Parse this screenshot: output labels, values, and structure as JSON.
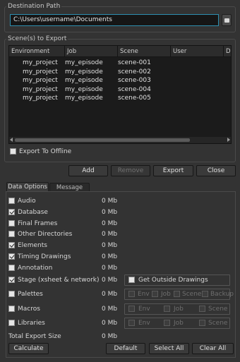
{
  "destination": {
    "legend": "Destination Path",
    "path": "C:\\Users\\username\\Documents"
  },
  "scenes": {
    "legend": "Scene(s) to Export",
    "columns": [
      "Environment",
      "Job",
      "Scene",
      "User",
      "Da"
    ],
    "rows": [
      {
        "environment": "my_project",
        "job": "my_episode",
        "scene": "scene-001"
      },
      {
        "environment": "my_project",
        "job": "my_episode",
        "scene": "scene-002"
      },
      {
        "environment": "my_project",
        "job": "my_episode",
        "scene": "scene-003"
      },
      {
        "environment": "my_project",
        "job": "my_episode",
        "scene": "scene-004"
      },
      {
        "environment": "my_project",
        "job": "my_episode",
        "scene": "scene-005"
      }
    ],
    "export_offline_label": "Export To Offline"
  },
  "actions": {
    "add": "Add",
    "remove": "Remove",
    "export": "Export",
    "close": "Close"
  },
  "tabs": [
    "Data Options",
    "Message Log"
  ],
  "options": [
    {
      "label": "Audio",
      "checked": false,
      "size": "0 Mb"
    },
    {
      "label": "Database",
      "checked": true,
      "size": "0 Mb"
    },
    {
      "label": "Final Frames",
      "checked": false,
      "size": "0 Mb"
    },
    {
      "label": "Other Directories",
      "checked": false,
      "size": "0 Mb"
    },
    {
      "label": "Elements",
      "checked": true,
      "size": "0 Mb"
    },
    {
      "label": "Timing Drawings",
      "checked": true,
      "size": "0 Mb"
    },
    {
      "label": "Annotation",
      "checked": false,
      "size": "0 Mb"
    },
    {
      "label": "Stage (xsheet & network)",
      "checked": true,
      "size": "0 Mb"
    },
    {
      "label": "Palettes",
      "checked": false,
      "size": "0 Mb"
    },
    {
      "label": "Macros",
      "checked": false,
      "size": "0 Mb"
    },
    {
      "label": "Libraries",
      "checked": false,
      "size": "0 Mb"
    }
  ],
  "get_outside_drawings": "Get Outside Drawings",
  "palette_sub": [
    "Env",
    "Job",
    "Scene",
    "Backup"
  ],
  "macro_sub": [
    "Env",
    "Job",
    "Scene"
  ],
  "library_sub": [
    "Env",
    "Job",
    "Scene"
  ],
  "total": {
    "label": "Total Export Size",
    "size": "0 Mb"
  },
  "bottom": {
    "calculate": "Calculate",
    "default": "Default",
    "select_all": "Select All",
    "clear_all": "Clear All"
  }
}
